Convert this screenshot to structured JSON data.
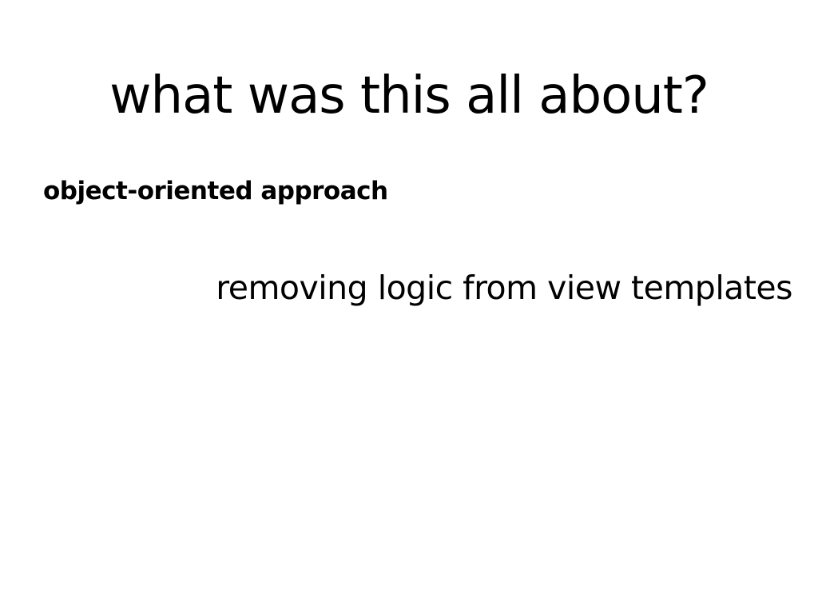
{
  "slide": {
    "title": "what was this all about?",
    "points": [
      "object-oriented approach",
      "removing logic from view templates"
    ]
  }
}
